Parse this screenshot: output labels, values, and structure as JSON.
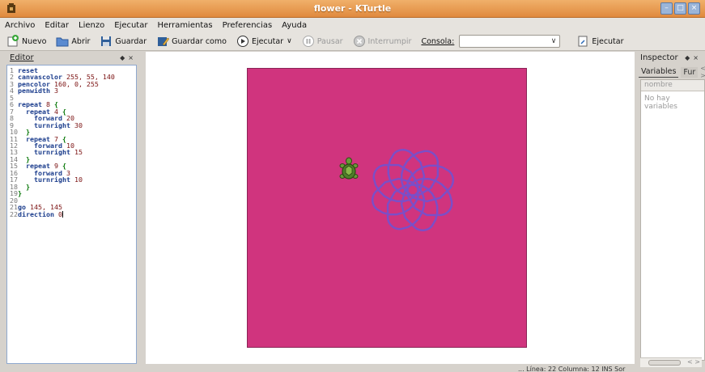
{
  "window": {
    "title": "flower - KTurtle"
  },
  "menu": [
    "Archivo",
    "Editar",
    "Lienzo",
    "Ejecutar",
    "Herramientas",
    "Preferencias",
    "Ayuda"
  ],
  "toolbar": {
    "new_label": "Nuevo",
    "open_label": "Abrir",
    "save_label": "Guardar",
    "save_as_label": "Guardar como",
    "run_label": "Ejecutar",
    "pause_label": "Pausar",
    "abort_label": "Interrumpir",
    "console_label": "Consola:",
    "console_value": "",
    "console_run_label": "Ejecutar"
  },
  "editor": {
    "title": "Editor",
    "lines": [
      {
        "n": "1",
        "kw": "reset",
        "args": ""
      },
      {
        "n": "2",
        "kw": "canvascolor",
        "args": "255, 55, 140"
      },
      {
        "n": "3",
        "kw": "pencolor",
        "args": "160, 0, 255"
      },
      {
        "n": "4",
        "kw": "penwidth",
        "args": "3"
      },
      {
        "n": "5",
        "kw": "",
        "args": ""
      },
      {
        "n": "6",
        "kw": "repeat",
        "args": "8 {"
      },
      {
        "n": "7",
        "kw": "  repeat",
        "args": "4 {"
      },
      {
        "n": "8",
        "kw": "    forward",
        "args": "20"
      },
      {
        "n": "9",
        "kw": "    turnright",
        "args": "30"
      },
      {
        "n": "10",
        "kw": "  }",
        "args": ""
      },
      {
        "n": "11",
        "kw": "  repeat",
        "args": "7 {"
      },
      {
        "n": "12",
        "kw": "    forward",
        "args": "10"
      },
      {
        "n": "13",
        "kw": "    turnright",
        "args": "15"
      },
      {
        "n": "14",
        "kw": "  }",
        "args": ""
      },
      {
        "n": "15",
        "kw": "  repeat",
        "args": "9 {"
      },
      {
        "n": "16",
        "kw": "    forward",
        "args": "3"
      },
      {
        "n": "17",
        "kw": "    turnright",
        "args": "10"
      },
      {
        "n": "18",
        "kw": "  }",
        "args": ""
      },
      {
        "n": "19",
        "kw": "}",
        "args": ""
      },
      {
        "n": "20",
        "kw": "",
        "args": ""
      },
      {
        "n": "21",
        "kw": "go",
        "args": "145, 145"
      },
      {
        "n": "22",
        "kw": "direction",
        "args": "0"
      }
    ]
  },
  "inspector": {
    "title": "Inspector",
    "tab_variables": "Variables",
    "tab_functions": "Fur",
    "column_name": "nombre",
    "empty_text": "No hay variables"
  },
  "status": {
    "text": "... Línea: 22 Columna: 12  INS  Sor"
  },
  "colors": {
    "canvas": "#d0347e",
    "pen": "#7a4fc8",
    "titlebar": "#e08a3e"
  }
}
